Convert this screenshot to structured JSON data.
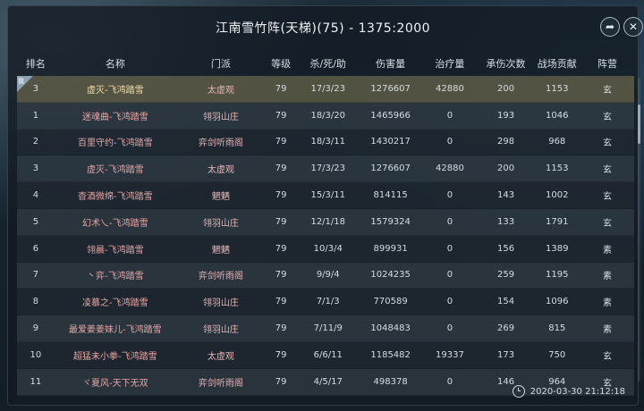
{
  "title": "江南雪竹阵(天梯)(75) - 1375:2000",
  "columns": [
    "排名",
    "名称",
    "门派",
    "等级",
    "杀/死/助",
    "伤害量",
    "治疗量",
    "承伤次数",
    "战场贡献",
    "阵营"
  ],
  "self_row": {
    "rank": "3",
    "name": "虚灭-飞鸿踏雪",
    "school": "太虚观",
    "level": "79",
    "kda": "17/3/23",
    "damage": "1276607",
    "heal": "42880",
    "hits": "200",
    "contribution": "1153",
    "camp": "玄",
    "badge": "我"
  },
  "rows": [
    {
      "rank": "1",
      "name": "迷魂曲-飞鸿踏雪",
      "school": "翎羽山庄",
      "level": "79",
      "kda": "18/3/20",
      "damage": "1465966",
      "heal": "0",
      "hits": "193",
      "contribution": "1046",
      "camp": "玄"
    },
    {
      "rank": "2",
      "name": "百里守约-飞鸿踏雪",
      "school": "弈剑听雨阁",
      "level": "79",
      "kda": "18/3/11",
      "damage": "1430217",
      "heal": "0",
      "hits": "298",
      "contribution": "968",
      "camp": "玄"
    },
    {
      "rank": "3",
      "name": "虚灭-飞鸿踏雪",
      "school": "太虚观",
      "level": "79",
      "kda": "17/3/23",
      "damage": "1276607",
      "heal": "42880",
      "hits": "200",
      "contribution": "1153",
      "camp": "玄"
    },
    {
      "rank": "4",
      "name": "杳酒微绵-飞鸿踏雪",
      "school": "魍魉",
      "level": "79",
      "kda": "15/3/11",
      "damage": "814115",
      "heal": "0",
      "hits": "143",
      "contribution": "1002",
      "camp": "玄"
    },
    {
      "rank": "5",
      "name": "幻术乀-飞鸿踏雪",
      "school": "翎羽山庄",
      "level": "79",
      "kda": "12/1/18",
      "damage": "1579324",
      "heal": "0",
      "hits": "133",
      "contribution": "1791",
      "camp": "玄"
    },
    {
      "rank": "6",
      "name": "翎晨-飞鸿踏雪",
      "school": "魍魉",
      "level": "79",
      "kda": "10/3/4",
      "damage": "899931",
      "heal": "0",
      "hits": "156",
      "contribution": "1389",
      "camp": "素"
    },
    {
      "rank": "7",
      "name": "丶弈-飞鸿踏雪",
      "school": "弈剑听雨阁",
      "level": "79",
      "kda": "9/9/4",
      "damage": "1024235",
      "heal": "0",
      "hits": "259",
      "contribution": "1195",
      "camp": "素"
    },
    {
      "rank": "8",
      "name": "凌慕之-飞鸿踏雪",
      "school": "翎羽山庄",
      "level": "79",
      "kda": "7/1/3",
      "damage": "770589",
      "heal": "0",
      "hits": "154",
      "contribution": "1096",
      "camp": "素"
    },
    {
      "rank": "9",
      "name": "最爱姜姜妹儿-飞鸿踏雪",
      "school": "翎羽山庄",
      "level": "79",
      "kda": "7/11/9",
      "damage": "1048483",
      "heal": "0",
      "hits": "269",
      "contribution": "815",
      "camp": "素"
    },
    {
      "rank": "10",
      "name": "超猛未小拳-飞鸿踏雪",
      "school": "太虚观",
      "level": "79",
      "kda": "6/6/11",
      "damage": "1185482",
      "heal": "19337",
      "hits": "173",
      "contribution": "750",
      "camp": "玄"
    },
    {
      "rank": "11",
      "name": "ヾ夏风-天下无双",
      "school": "弈剑听雨阁",
      "level": "79",
      "kda": "4/5/17",
      "damage": "498378",
      "heal": "0",
      "hits": "146",
      "contribution": "964",
      "camp": "玄"
    }
  ],
  "timestamp": "2020-03-30 21:12:18",
  "icons": {
    "share": "share-arrow-icon",
    "close": "close-icon",
    "clock": "clock-icon"
  }
}
